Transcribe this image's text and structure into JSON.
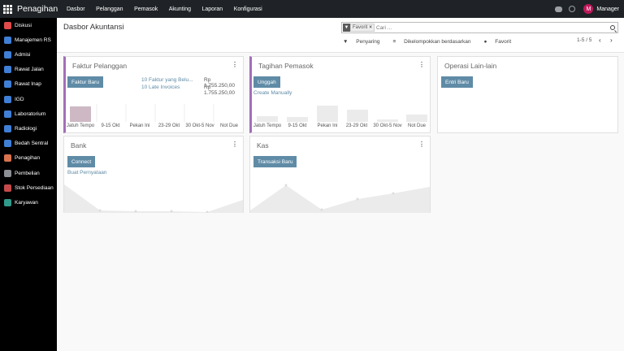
{
  "app": {
    "name": "Penagihan"
  },
  "top_menu": [
    "Dasbor",
    "Pelanggan",
    "Pemasok",
    "Akunting",
    "Laporan",
    "Konfigurasi"
  ],
  "user": {
    "initial": "M",
    "name": "Manager",
    "avatar_color": "#c2185b"
  },
  "sidebar": {
    "items": [
      {
        "label": "Diskusi",
        "icon": "chat-icon",
        "color": "#e04b4b"
      },
      {
        "label": "Manajemen RS",
        "icon": "building-icon",
        "color": "#3f7fd6"
      },
      {
        "label": "Admisi",
        "icon": "admission-icon",
        "color": "#3f7fd6"
      },
      {
        "label": "Rawat Jalan",
        "icon": "outpatient-icon",
        "color": "#3f7fd6"
      },
      {
        "label": "Rawat Inap",
        "icon": "bed-icon",
        "color": "#3f7fd6"
      },
      {
        "label": "IGD",
        "icon": "emergency-icon",
        "color": "#3f7fd6"
      },
      {
        "label": "Laboratorium",
        "icon": "lab-icon",
        "color": "#3f7fd6"
      },
      {
        "label": "Radiologi",
        "icon": "radiology-icon",
        "color": "#3f7fd6"
      },
      {
        "label": "Bedah Sentral",
        "icon": "surgery-icon",
        "color": "#3f7fd6"
      },
      {
        "label": "Penagihan",
        "icon": "invoice-icon",
        "color": "#d9734e"
      },
      {
        "label": "Pembelian",
        "icon": "cart-icon",
        "color": "#8c8f94"
      },
      {
        "label": "Stok Persediaan",
        "icon": "box-icon",
        "color": "#c44a4a"
      },
      {
        "label": "Karyawan",
        "icon": "people-icon",
        "color": "#2f9a8a"
      }
    ]
  },
  "control": {
    "title": "Dasbor Akuntansi",
    "filter_tag": "Favorit",
    "search_placeholder": "Cari ...",
    "options": [
      "Penyaring",
      "Dikelompokkan berdasarkan",
      "Favorit"
    ],
    "pager": "1-5 / 5"
  },
  "cards": {
    "faktur": {
      "title": "Faktur Pelanggan",
      "button": "Faktur Baru",
      "rows": [
        {
          "label": "10 Faktur yang Belu...",
          "amount": "Rp 1.755.250,00"
        },
        {
          "label": "10 Late Invoices",
          "amount": "Rp 1.755.250,00"
        }
      ],
      "chart_labels": [
        "Jatuh Tempo",
        "9-15 Okt",
        "Pekan Ini",
        "23-29 Okt",
        "30 Okt-5 Nov",
        "Not Due"
      ]
    },
    "tagihan": {
      "title": "Tagihan Pemasok",
      "button": "Unggah",
      "link": "Create Manually",
      "chart_labels": [
        "Jatuh Tempo",
        "9-15 Okt",
        "Pekan Ini",
        "23-29 Okt",
        "30 Okt-5 Nov",
        "Not Due"
      ]
    },
    "operasi": {
      "title": "Operasi Lain-lain",
      "button": "Entri Baru"
    },
    "bank": {
      "title": "Bank",
      "button": "Connect",
      "link": "Buat Pernyataan"
    },
    "kas": {
      "title": "Kas",
      "button": "Transaksi Baru"
    }
  }
}
